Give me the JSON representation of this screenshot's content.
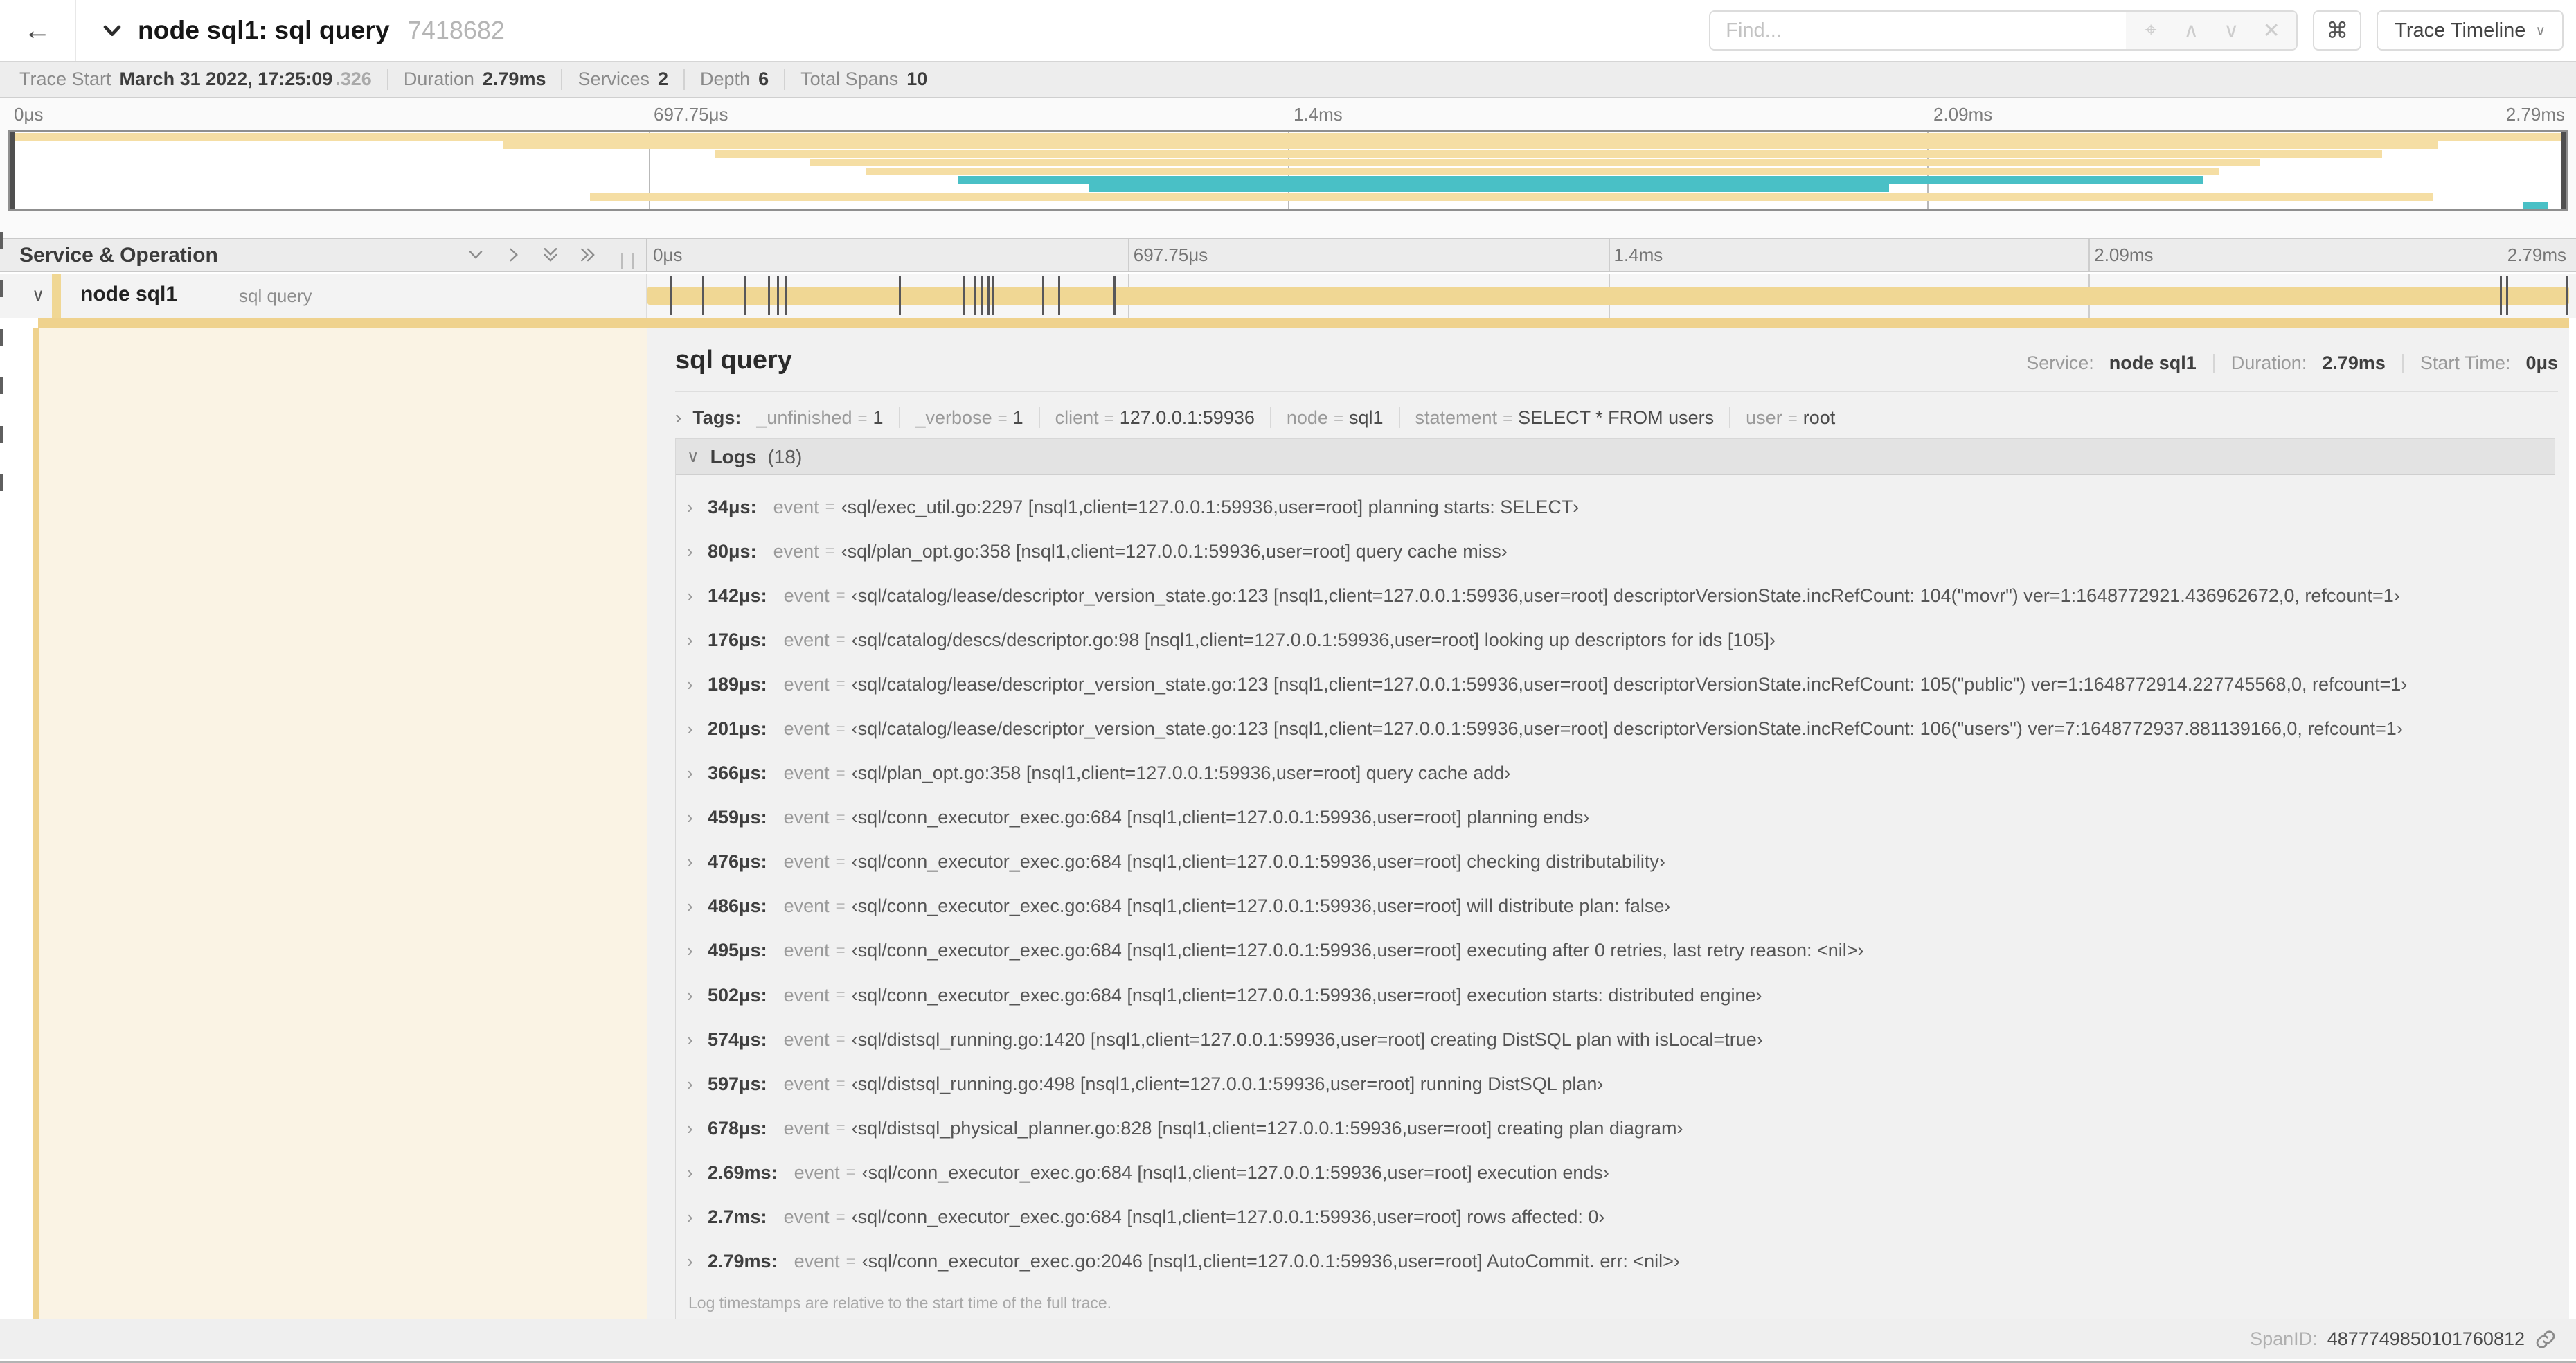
{
  "header": {
    "back_icon": "←",
    "title": "node sql1: sql query",
    "trace_id": "7418682",
    "find_placeholder": "Find...",
    "find_icons": {
      "locate": "⌖",
      "prev": "∧",
      "next": "∨",
      "clear": "✕"
    },
    "shortcut_button": "⌘",
    "view_selector": "Trace Timeline",
    "view_caret": "∨"
  },
  "summary": {
    "items": [
      {
        "label": "Trace Start",
        "value": "March 31 2022, 17:25:09",
        "suffix": ".326"
      },
      {
        "label": "Duration",
        "value": "2.79ms"
      },
      {
        "label": "Services",
        "value": "2"
      },
      {
        "label": "Depth",
        "value": "6"
      },
      {
        "label": "Total Spans",
        "value": "10"
      }
    ]
  },
  "colors": {
    "span_tan": "#f0d794",
    "mini_tan": "#f5dea4",
    "teal": "#49c0c6",
    "accent": "#efd28d",
    "cream": "#faf3e4"
  },
  "ruler_ticks": [
    "0μs",
    "697.75μs",
    "1.4ms",
    "2.09ms",
    "2.79ms"
  ],
  "minimap": {
    "spans": [
      {
        "color": "tan",
        "start": 0,
        "end": 100
      },
      {
        "color": "tan",
        "start": 19.3,
        "end": 95.0
      },
      {
        "color": "tan",
        "start": 27.6,
        "end": 92.8
      },
      {
        "color": "tan",
        "start": 31.3,
        "end": 88.0
      },
      {
        "color": "tan",
        "start": 33.5,
        "end": 86.4
      },
      {
        "color": "teal",
        "start": 37.1,
        "end": 85.8
      },
      {
        "color": "teal",
        "start": 42.2,
        "end": 73.5
      },
      {
        "color": "tan",
        "start": 22.7,
        "end": 94.8
      },
      {
        "color": "teal",
        "start": 98.3,
        "end": 99.3
      }
    ]
  },
  "timeline": {
    "column_header": "Service & Operation",
    "duration_us": 2790
  },
  "span_row": {
    "expander": "∨",
    "service": "node sql1",
    "operation": "sql query"
  },
  "detail": {
    "title": "sql query",
    "meta": [
      {
        "label": "Service:",
        "value": "node sql1"
      },
      {
        "label": "Duration:",
        "value": "2.79ms"
      },
      {
        "label": "Start Time:",
        "value": "0μs"
      }
    ],
    "tags_chevron": "›",
    "tags_label": "Tags:",
    "tags": [
      {
        "key": "_unfinished",
        "value": "1"
      },
      {
        "key": "_verbose",
        "value": "1"
      },
      {
        "key": "client",
        "value": "127.0.0.1:59936"
      },
      {
        "key": "node",
        "value": "sql1"
      },
      {
        "key": "statement",
        "value": "SELECT * FROM users"
      },
      {
        "key": "user",
        "value": "root"
      }
    ],
    "logs_chevron": "∨",
    "logs_label": "Logs",
    "logs_count": "(18)",
    "log_row_chevron": "›",
    "logs": [
      {
        "time": "34μs:",
        "t_us": 34,
        "key": "event",
        "value": "‹sql/exec_util.go:2297 [nsql1,client=127.0.0.1:59936,user=root] planning starts: SELECT›"
      },
      {
        "time": "80μs:",
        "t_us": 80,
        "key": "event",
        "value": "‹sql/plan_opt.go:358 [nsql1,client=127.0.0.1:59936,user=root] query cache miss›"
      },
      {
        "time": "142μs:",
        "t_us": 142,
        "key": "event",
        "value": "‹sql/catalog/lease/descriptor_version_state.go:123 [nsql1,client=127.0.0.1:59936,user=root] descriptorVersionState.incRefCount: 104(\"movr\") ver=1:1648772921.436962672,0, refcount=1›"
      },
      {
        "time": "176μs:",
        "t_us": 176,
        "key": "event",
        "value": "‹sql/catalog/descs/descriptor.go:98 [nsql1,client=127.0.0.1:59936,user=root] looking up descriptors for ids [105]›"
      },
      {
        "time": "189μs:",
        "t_us": 189,
        "key": "event",
        "value": "‹sql/catalog/lease/descriptor_version_state.go:123 [nsql1,client=127.0.0.1:59936,user=root] descriptorVersionState.incRefCount: 105(\"public\") ver=1:1648772914.227745568,0, refcount=1›"
      },
      {
        "time": "201μs:",
        "t_us": 201,
        "key": "event",
        "value": "‹sql/catalog/lease/descriptor_version_state.go:123 [nsql1,client=127.0.0.1:59936,user=root] descriptorVersionState.incRefCount: 106(\"users\") ver=7:1648772937.881139166,0, refcount=1›"
      },
      {
        "time": "366μs:",
        "t_us": 366,
        "key": "event",
        "value": "‹sql/plan_opt.go:358 [nsql1,client=127.0.0.1:59936,user=root] query cache add›"
      },
      {
        "time": "459μs:",
        "t_us": 459,
        "key": "event",
        "value": "‹sql/conn_executor_exec.go:684 [nsql1,client=127.0.0.1:59936,user=root] planning ends›"
      },
      {
        "time": "476μs:",
        "t_us": 476,
        "key": "event",
        "value": "‹sql/conn_executor_exec.go:684 [nsql1,client=127.0.0.1:59936,user=root] checking distributability›"
      },
      {
        "time": "486μs:",
        "t_us": 486,
        "key": "event",
        "value": "‹sql/conn_executor_exec.go:684 [nsql1,client=127.0.0.1:59936,user=root] will distribute plan: false›"
      },
      {
        "time": "495μs:",
        "t_us": 495,
        "key": "event",
        "value": "‹sql/conn_executor_exec.go:684 [nsql1,client=127.0.0.1:59936,user=root] executing after 0 retries, last retry reason: <nil>›"
      },
      {
        "time": "502μs:",
        "t_us": 502,
        "key": "event",
        "value": "‹sql/conn_executor_exec.go:684 [nsql1,client=127.0.0.1:59936,user=root] execution starts: distributed engine›"
      },
      {
        "time": "574μs:",
        "t_us": 574,
        "key": "event",
        "value": "‹sql/distsql_running.go:1420 [nsql1,client=127.0.0.1:59936,user=root] creating DistSQL plan with isLocal=true›"
      },
      {
        "time": "597μs:",
        "t_us": 597,
        "key": "event",
        "value": "‹sql/distsql_running.go:498 [nsql1,client=127.0.0.1:59936,user=root] running DistSQL plan›"
      },
      {
        "time": "678μs:",
        "t_us": 678,
        "key": "event",
        "value": "‹sql/distsql_physical_planner.go:828 [nsql1,client=127.0.0.1:59936,user=root] creating plan diagram›"
      },
      {
        "time": "2.69ms:",
        "t_us": 2690,
        "key": "event",
        "value": "‹sql/conn_executor_exec.go:684 [nsql1,client=127.0.0.1:59936,user=root] execution ends›"
      },
      {
        "time": "2.7ms:",
        "t_us": 2700,
        "key": "event",
        "value": "‹sql/conn_executor_exec.go:684 [nsql1,client=127.0.0.1:59936,user=root] rows affected: 0›"
      },
      {
        "time": "2.79ms:",
        "t_us": 2790,
        "key": "event",
        "value": "‹sql/conn_executor_exec.go:2046 [nsql1,client=127.0.0.1:59936,user=root] AutoCommit. err: <nil>›"
      }
    ],
    "logs_footnote": "Log timestamps are relative to the start time of the full trace.",
    "span_id_label": "SpanID:",
    "span_id": "4877749850101760812"
  }
}
